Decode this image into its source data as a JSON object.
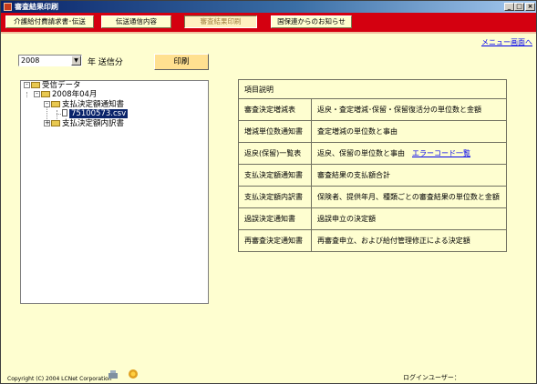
{
  "window": {
    "title": "審査結果印刷"
  },
  "menu": {
    "items": [
      {
        "label": "介護給付費請求書･伝送"
      },
      {
        "label": "伝送通信内容"
      },
      {
        "label": "審査結果印刷"
      },
      {
        "label": "国保連からのお知らせ"
      }
    ]
  },
  "top_link": "メニュー画面へ",
  "year_select": {
    "value": "2008",
    "suffix": "年 送信分"
  },
  "print_button": "印刷",
  "tree": {
    "root": "受信データ",
    "month": "2008年04月",
    "folder1": "支払決定額通知書",
    "file1": "75100573.csv",
    "folder2": "支払決定額内訳書"
  },
  "info_table": {
    "header": "項目説明",
    "rows": [
      {
        "name": "審査決定増減表",
        "desc": "返戻・査定増減･保留・保留復活分の単位数と金額",
        "link": ""
      },
      {
        "name": "増減単位数通知書",
        "desc": "査定増減の単位数と事由",
        "link": ""
      },
      {
        "name": "返戻(保留)一覧表",
        "desc": "返戻、保留の単位数と事由",
        "link": "エラーコード一覧"
      },
      {
        "name": "支払決定額通知書",
        "desc": "審査結果の支払額合計",
        "link": ""
      },
      {
        "name": "支払決定額内訳書",
        "desc": "保険者、提供年月、種類ごとの審査結果の単位数と金額",
        "link": ""
      },
      {
        "name": "過誤決定通知書",
        "desc": "過誤申立の決定額",
        "link": ""
      },
      {
        "name": "再審査決定通知書",
        "desc": "再審査申立、および給付管理修正による決定額",
        "link": ""
      }
    ]
  },
  "footer": {
    "copyright": "Copyright (C) 2004 LCNet Corporation",
    "login_label": "ログインユーザー："
  }
}
